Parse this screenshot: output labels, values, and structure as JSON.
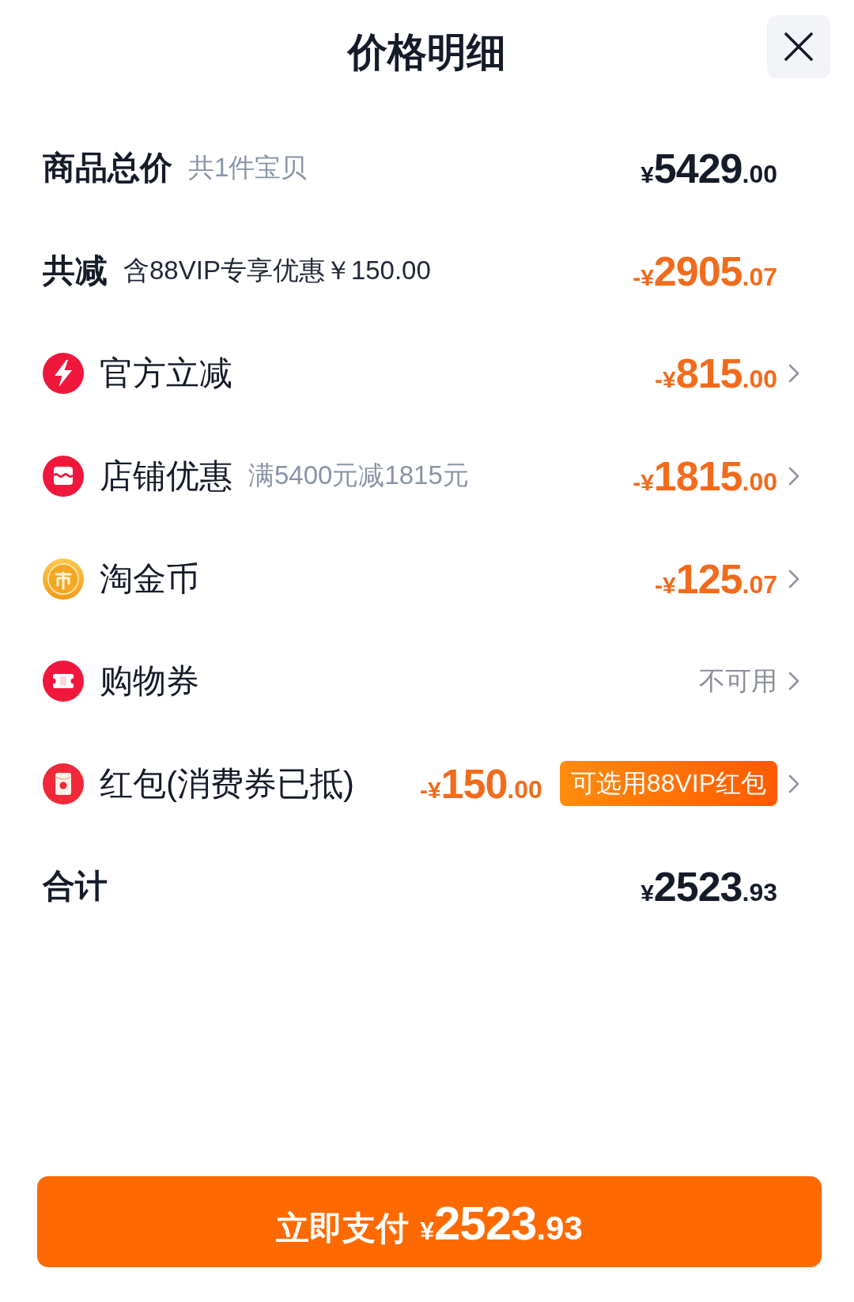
{
  "header": {
    "title": "价格明细"
  },
  "subtotal": {
    "label": "商品总价",
    "note": "共1件宝贝",
    "amount": {
      "symbol": "¥",
      "whole": "5429",
      "fraction": ".00"
    }
  },
  "savings": {
    "label": "共减",
    "note": "含88VIP专享优惠￥150.00",
    "amount": {
      "symbol": "-¥",
      "whole": "2905",
      "fraction": ".07"
    }
  },
  "discounts": [
    {
      "label": "官方立减",
      "amount": {
        "symbol": "-¥",
        "whole": "815",
        "fraction": ".00"
      }
    },
    {
      "label": "店铺优惠",
      "note": "满5400元减1815元",
      "amount": {
        "symbol": "-¥",
        "whole": "1815",
        "fraction": ".00"
      }
    },
    {
      "label": "淘金币",
      "amount": {
        "symbol": "-¥",
        "whole": "125",
        "fraction": ".07"
      }
    },
    {
      "label": "购物券",
      "status": "不可用"
    },
    {
      "label": "红包(消费券已抵)",
      "amount": {
        "symbol": "-¥",
        "whole": "150",
        "fraction": ".00"
      },
      "tag": "可选用88VIP红包"
    }
  ],
  "total": {
    "label": "合计",
    "amount": {
      "symbol": "¥",
      "whole": "2523",
      "fraction": ".93"
    }
  },
  "pay_button": {
    "label": "立即支付",
    "amount": {
      "symbol": "¥",
      "whole": "2523",
      "fraction": ".93"
    }
  }
}
